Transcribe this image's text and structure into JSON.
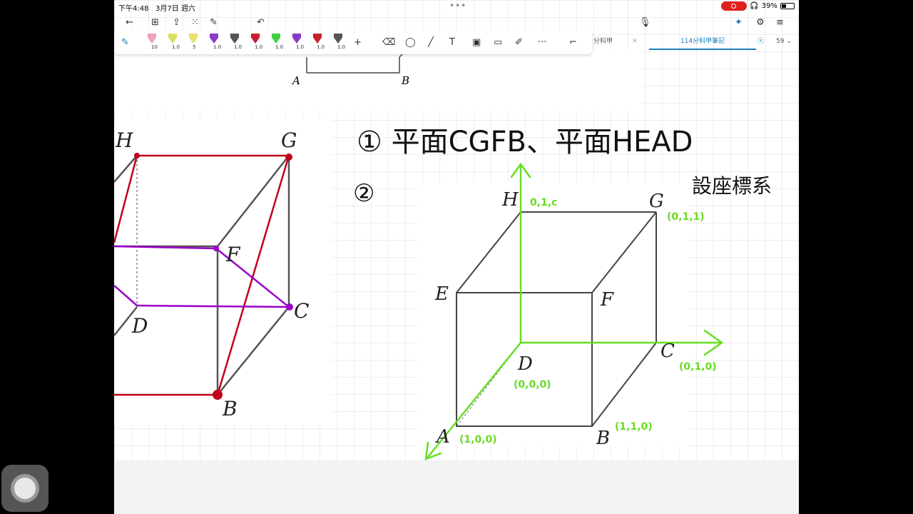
{
  "status_bar": {
    "time": "下午4:48",
    "date": "3月7日 週六",
    "battery": "39%",
    "battery_level": 0.39,
    "record_color": "#e0201e"
  },
  "toolbar": {
    "pens": [
      {
        "icon": "pen-icon",
        "size": "10",
        "color": "#f0a0c0"
      },
      {
        "icon": "pen-icon",
        "size": "1.0",
        "color": "#d8e060"
      },
      {
        "icon": "pen-icon",
        "size": "5",
        "color": "#e8e070"
      },
      {
        "icon": "pen-icon",
        "size": "1.0",
        "color": "#8a3cc8"
      },
      {
        "icon": "pen-icon",
        "size": "1.0",
        "color": "#555555"
      },
      {
        "icon": "pen-icon",
        "size": "1.0",
        "color": "#c82030"
      },
      {
        "icon": "pen-icon",
        "size": "1.0",
        "color": "#40d040"
      },
      {
        "icon": "pen-icon",
        "size": "1.0",
        "color": "#8a3cc8"
      },
      {
        "icon": "pen-icon",
        "size": "1.0",
        "color": "#c82030"
      },
      {
        "icon": "pen-icon",
        "size": "1.0",
        "color": "#555555"
      }
    ],
    "more_label": "···",
    "add_label": "+"
  },
  "tabs": {
    "inactive_label": "分科甲",
    "active_label": "114分科甲筆記",
    "page_count": "59"
  },
  "notes": {
    "line1": "① 平面CGFB、平面HEAD",
    "line2": "②",
    "side_note": "設座標系"
  },
  "left_cube": {
    "labels": [
      "H",
      "G",
      "F",
      "D",
      "C",
      "B"
    ]
  },
  "top_cube": {
    "labels": [
      "A",
      "B"
    ]
  },
  "right_cube": {
    "labels": [
      "H",
      "G",
      "E",
      "F",
      "D",
      "C",
      "A",
      "B"
    ],
    "coords": [
      "0,1,c",
      "(0,1,1)",
      "(0,0,0)",
      "(0,1,0)",
      "(1,0,0)",
      "(1,1,0)"
    ]
  },
  "colors": {
    "red": "#c0001a",
    "purple": "#9a00c8",
    "green": "#66dd22",
    "grid": "#dcdcdc"
  }
}
